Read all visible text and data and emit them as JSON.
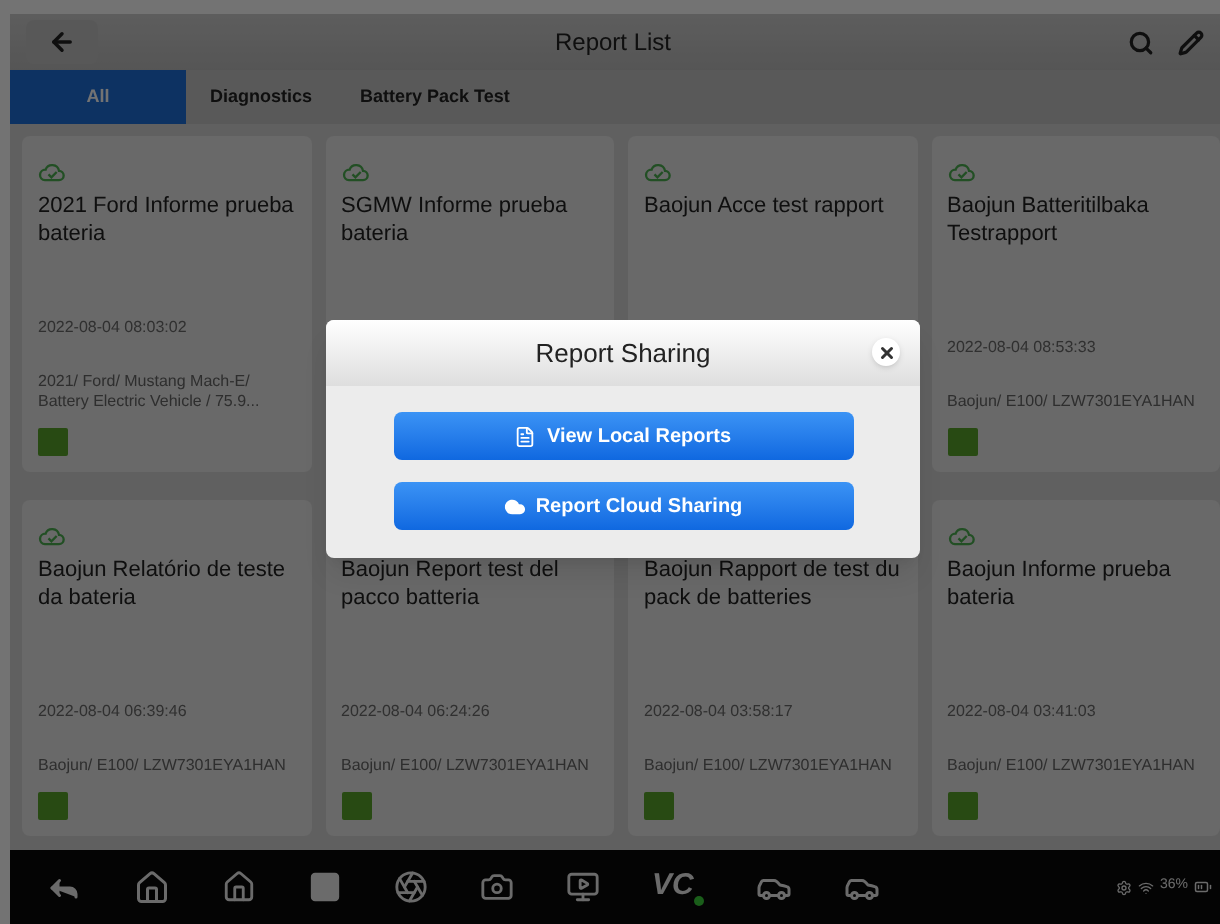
{
  "header": {
    "title": "Report List"
  },
  "tabs": [
    {
      "label": "All",
      "selected": true
    },
    {
      "label": "Diagnostics",
      "selected": false
    },
    {
      "label": "Battery Pack Test",
      "selected": false
    }
  ],
  "reports": [
    {
      "title": "2021 Ford Informe prueba bateria",
      "date": "2022-08-04 08:03:02",
      "vehicle": "2021/ Ford/ Mustang Mach-E/ Battery Electric Vehicle / 75.9..."
    },
    {
      "title": "SGMW Informe prueba bateria"
    },
    {
      "title": "Baojun Acce test rapport"
    },
    {
      "title": "Baojun Batteritilbaka Testrapport",
      "date": "2022-08-04 08:53:33",
      "vehicle": "Baojun/ E100/ LZW7301EYA1HAN"
    },
    {
      "title": "Baojun Relatório de teste da bateria",
      "date": "2022-08-04 06:39:46",
      "vehicle": "Baojun/ E100/ LZW7301EYA1HAN"
    },
    {
      "title": "Baojun Report test del pacco batteria",
      "date": "2022-08-04 06:24:26",
      "vehicle": "Baojun/ E100/ LZW7301EYA1HAN"
    },
    {
      "title": "Baojun Rapport de test du pack de batteries",
      "date": "2022-08-04 03:58:17",
      "vehicle": "Baojun/ E100/ LZW7301EYA1HAN"
    },
    {
      "title": "Baojun Informe prueba bateria",
      "date": "2022-08-04 03:41:03",
      "vehicle": "Baojun/ E100/ LZW7301EYA1HAN"
    }
  ],
  "dialog": {
    "title": "Report Sharing",
    "buttons": [
      {
        "kind": "local",
        "label": "View Local Reports"
      },
      {
        "kind": "cloud",
        "label": "Report Cloud Sharing"
      }
    ]
  },
  "navbar": {
    "vci_label": "VC",
    "battery": "36%"
  }
}
